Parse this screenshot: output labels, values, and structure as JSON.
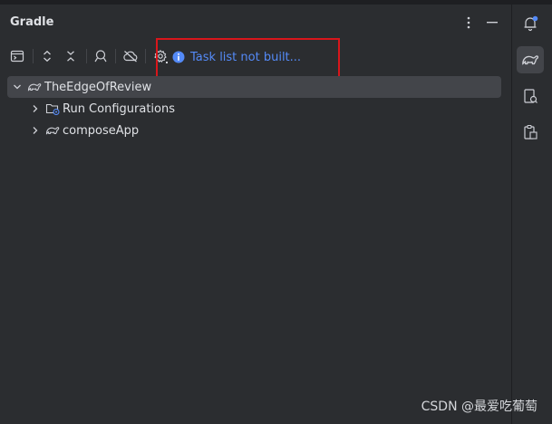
{
  "panel": {
    "title": "Gradle"
  },
  "toolbar": {
    "status_text": "Task list not built..."
  },
  "tree": {
    "root_label": "TheEdgeOfReview",
    "children": [
      {
        "label": "Run Configurations"
      },
      {
        "label": "composeApp"
      }
    ]
  },
  "watermark": "CSDN @最爱吃葡萄",
  "colors": {
    "status": "#548af7",
    "highlight": "#d8161b",
    "notification_dot": "#548af7"
  },
  "icons": {
    "header": [
      "more-vert-icon",
      "minimize-icon"
    ],
    "toolbar": [
      "execute-task-icon",
      "expand-all-icon",
      "collapse-all-icon",
      "analyze-dependencies-icon",
      "offline-mode-icon",
      "settings-icon",
      "info-icon"
    ],
    "strip": [
      "notifications-icon",
      "gradle-icon",
      "device-manager-icon",
      "clipboard-icon"
    ]
  }
}
